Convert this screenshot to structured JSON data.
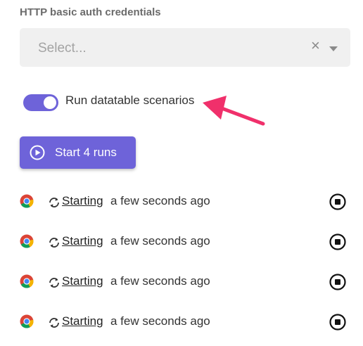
{
  "auth": {
    "heading": "HTTP basic auth credentials",
    "placeholder": "Select...",
    "clear_glyph": "×"
  },
  "toggle": {
    "label": "Run datatable scenarios",
    "checked": true
  },
  "start_button": {
    "label": "Start 4 runs"
  },
  "runs": [
    {
      "browser_icon": "chrome-icon",
      "status": "Starting",
      "time": "a few seconds ago"
    },
    {
      "browser_icon": "chrome-icon",
      "status": "Starting",
      "time": "a few seconds ago"
    },
    {
      "browser_icon": "chrome-icon",
      "status": "Starting",
      "time": "a few seconds ago"
    },
    {
      "browser_icon": "chrome-icon",
      "status": "Starting",
      "time": "a few seconds ago"
    }
  ],
  "colors": {
    "accent": "#6e63d9",
    "annotation_arrow": "#f0306b"
  }
}
